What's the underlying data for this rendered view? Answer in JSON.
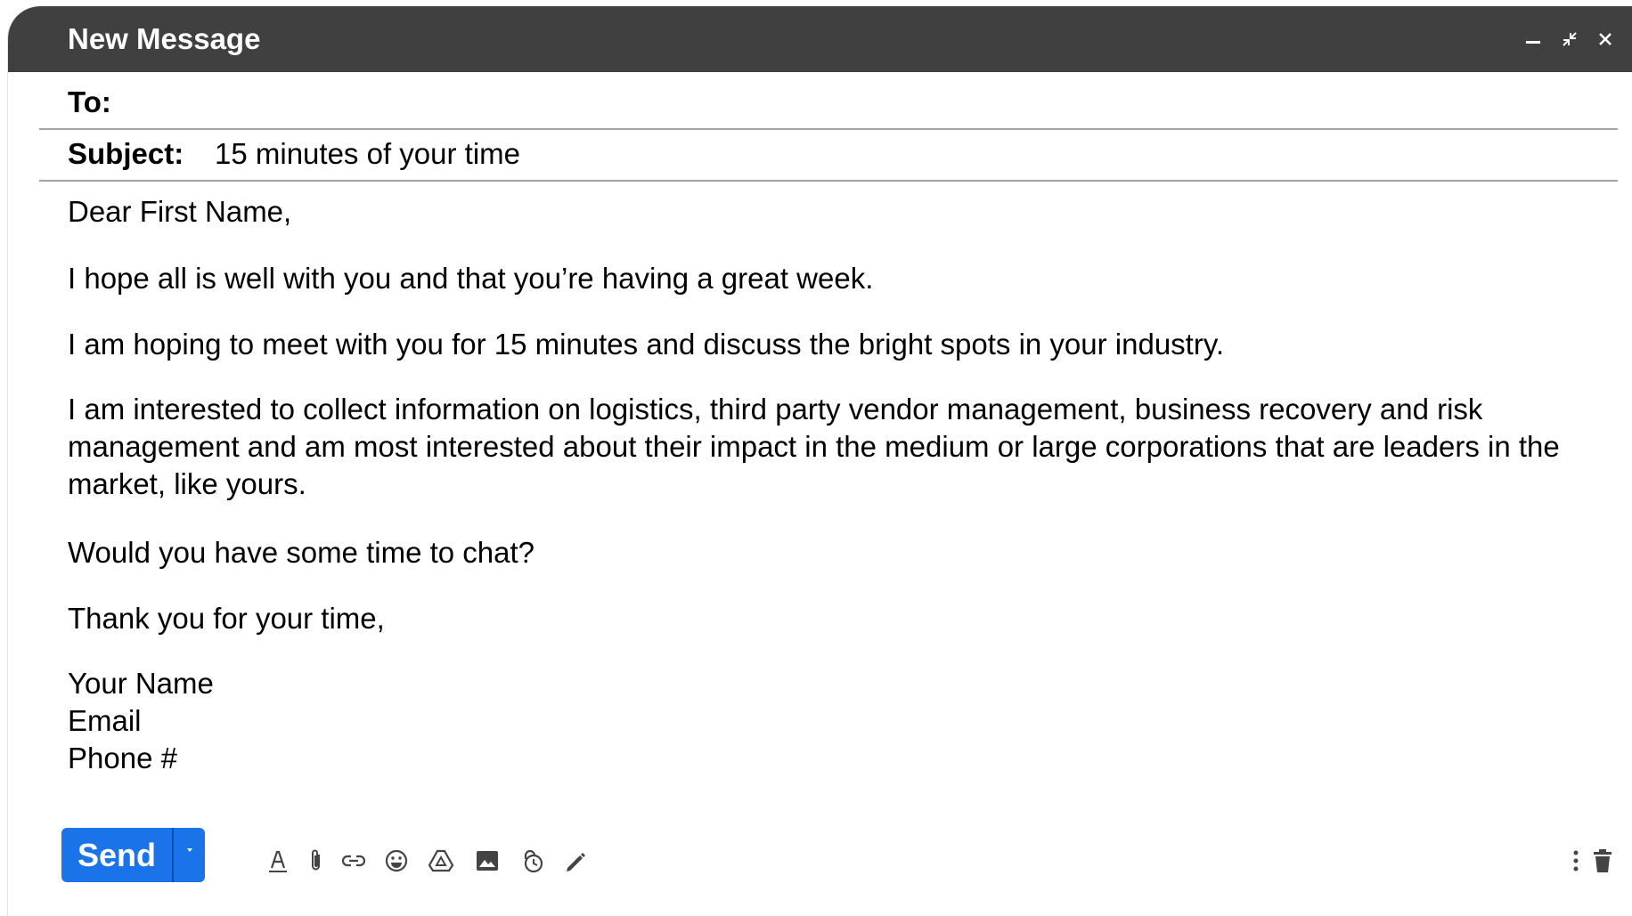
{
  "window": {
    "title": "New Message"
  },
  "fields": {
    "to_label": "To:",
    "to_value": "",
    "subject_label": "Subject:",
    "subject_value": "15 minutes of your time"
  },
  "body": {
    "greeting": "Dear First Name,",
    "paragraph_1": "I hope all is well with you and that you’re having a great week.",
    "paragraph_2": "I am hoping to meet with you for 15 minutes and discuss the bright spots in your industry.",
    "paragraph_3": "I am interested to collect information on logistics, third party vendor management, business recovery and risk management and am most interested about their impact in the medium or large corporations that are leaders in the market, like yours.",
    "paragraph_4": "Would you have some time to chat?",
    "closing": "Thank you for your time,",
    "signature": [
      "Your Name",
      "Email",
      "Phone #"
    ]
  },
  "toolbar": {
    "send_label": "Send",
    "icons": [
      "formatting-icon",
      "attach-icon",
      "link-icon",
      "emoji-icon",
      "drive-icon",
      "photo-icon",
      "confidential-icon",
      "signature-icon",
      "more-options-icon",
      "trash-icon"
    ]
  },
  "colors": {
    "titlebar": "#404040",
    "send_button": "#1a73e8",
    "divider": "#a3a3a3"
  }
}
